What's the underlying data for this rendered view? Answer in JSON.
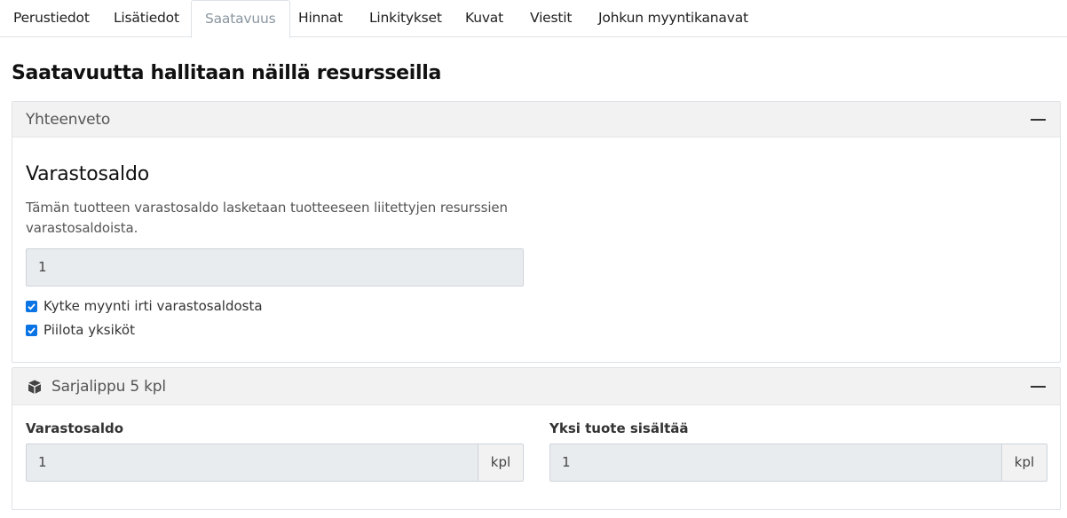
{
  "tabs": [
    {
      "label": "Perustiedot"
    },
    {
      "label": "Lisätiedot"
    },
    {
      "label": "Saatavuus"
    },
    {
      "label": "Hinnat"
    },
    {
      "label": "Linkitykset"
    },
    {
      "label": "Kuvat"
    },
    {
      "label": "Viestit"
    },
    {
      "label": "Johkun myyntikanavat"
    }
  ],
  "active_tab": "Saatavuus",
  "page_title": "Saatavuutta hallitaan näillä resursseilla",
  "summary": {
    "header": "Yhteenveto",
    "heading": "Varastosaldo",
    "description": "Tämän tuotteen varastosaldo lasketaan tuotteeseen liitettyjen resurssien varastosaldoista.",
    "stock_value": "1",
    "checkboxes": [
      {
        "label": "Kytke myynti irti varastosaldosta",
        "checked": true
      },
      {
        "label": "Piilota yksiköt",
        "checked": true
      }
    ]
  },
  "resource": {
    "header": "Sarjalippu 5 kpl",
    "icon": "box-icon",
    "stock_label": "Varastosaldo",
    "stock_value": "1",
    "stock_unit": "kpl",
    "contains_label": "Yksi tuote sisältää",
    "contains_value": "1",
    "contains_unit": "kpl"
  },
  "colors": {
    "checkbox_accent": "#0b74e5",
    "active_tab_text": "#8a96a0"
  }
}
